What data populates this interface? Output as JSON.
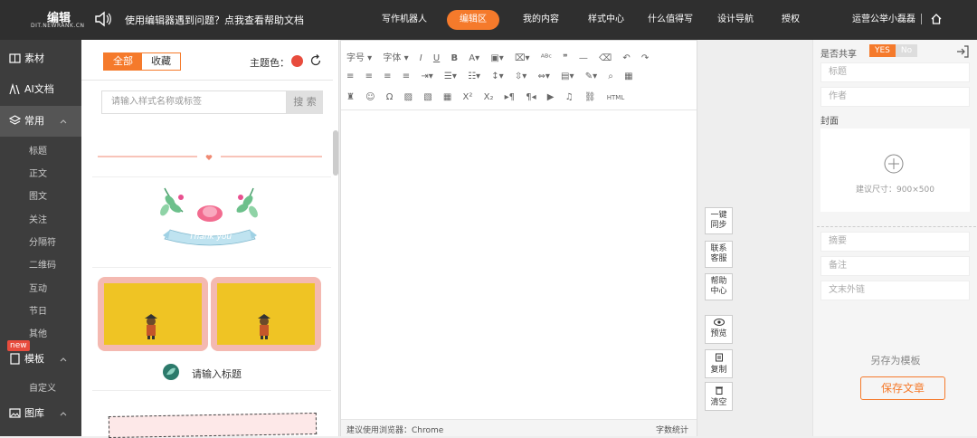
{
  "topbar": {
    "logo_text": "编辑",
    "logo_sub": "DIT.NEWRANK.CN",
    "notice": "使用编辑器遇到问题？点我查看帮助文档",
    "nav": [
      "写作机器人",
      "编辑区",
      "我的内容",
      "样式中心",
      "什么值得写",
      "设计导航",
      "授权"
    ],
    "nav_active": "编辑区",
    "account": "运营公举小磊磊",
    "accent_color": "#f57a2b"
  },
  "leftnav": {
    "items": [
      {
        "label": "素材",
        "icon": "book-icon"
      },
      {
        "label": "AI文档",
        "icon": "ai-icon"
      },
      {
        "label": "常用",
        "icon": "layers-icon"
      }
    ],
    "sub_items": [
      "标题",
      "正文",
      "图文",
      "关注",
      "分隔符",
      "二维码",
      "互动",
      "节日",
      "其他"
    ],
    "template": {
      "label": "模板",
      "badge": "new",
      "icon": "template-icon"
    },
    "template_sub": "自定义",
    "gallery": {
      "label": "图库",
      "icon": "image-icon"
    }
  },
  "stylepanel": {
    "tabs": [
      "全部",
      "收藏"
    ],
    "active_tab": "全部",
    "theme_label": "主题色：",
    "theme_color": "#e84c3d",
    "search_placeholder": "请输入样式名称或标签",
    "search_button": "搜 索",
    "thank_text": "Thank you",
    "card_title": "请输入标题"
  },
  "editor": {
    "toolbar_row1": [
      "字号",
      "字体"
    ],
    "bottom_left": "建议使用浏览器：Chrome",
    "bottom_right": "字数统计"
  },
  "side_buttons": [
    "一键同步",
    "联系客服",
    "帮助中心",
    "预览",
    "复制",
    "清空"
  ],
  "rightpanel": {
    "share_label": "是否共享",
    "yes": "YES",
    "no": "No",
    "title_placeholder": "标题",
    "author_placeholder": "作者",
    "cover_label": "封面",
    "cover_hint": "建议尺寸：900×500",
    "summary_placeholder": "摘要",
    "note_placeholder": "备注",
    "link_placeholder": "文末外链",
    "save_as_template": "另存为模板",
    "save_article": "保存文章"
  }
}
